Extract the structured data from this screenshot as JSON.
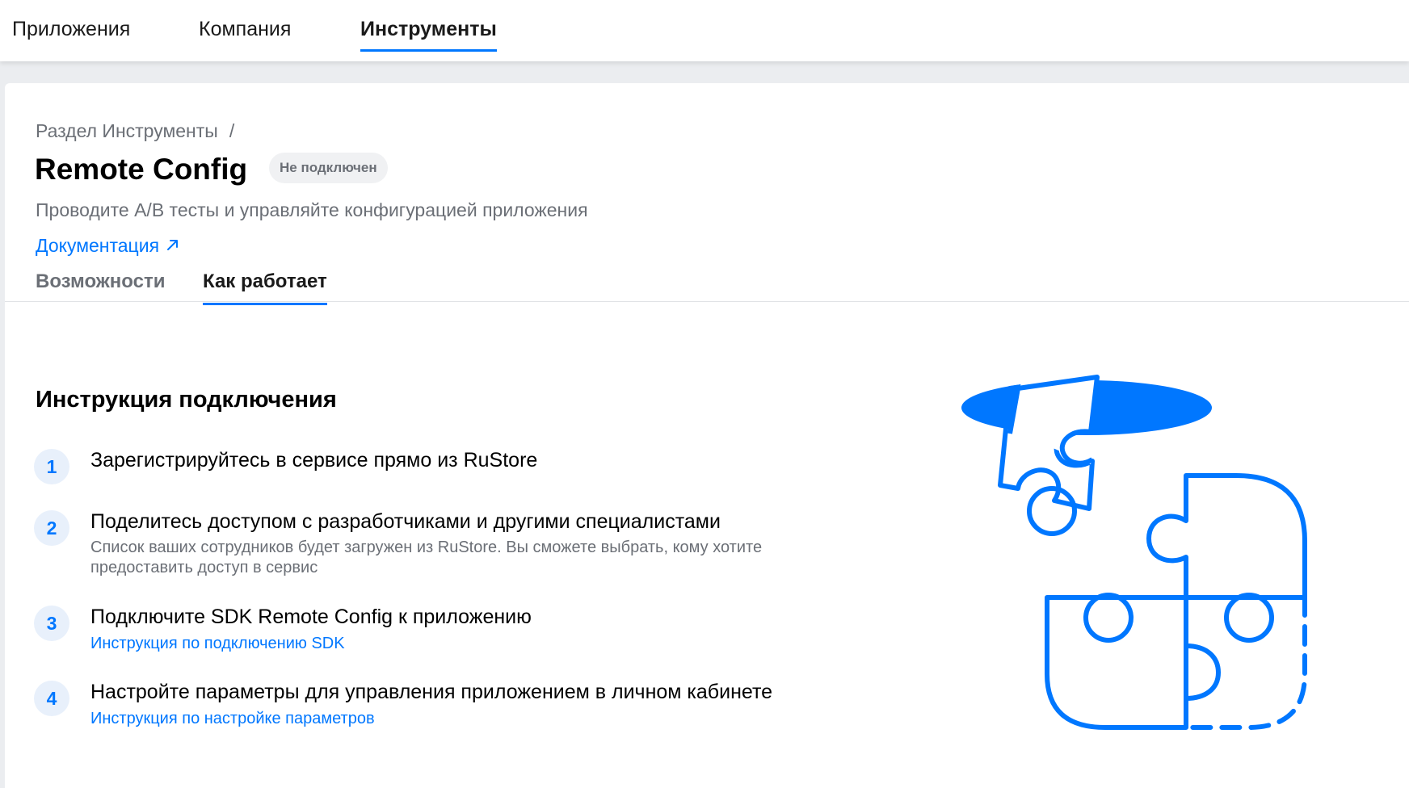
{
  "topnav": {
    "items": [
      {
        "label": "Приложения",
        "active": false
      },
      {
        "label": "Компания",
        "active": false
      },
      {
        "label": "Инструменты",
        "active": true
      }
    ]
  },
  "header": {
    "breadcrumb": "Раздел Инструменты",
    "breadcrumb_separator": "/",
    "title": "Remote Config",
    "status_badge": "Не подключен",
    "subtitle": "Проводите A/B тесты и управляйте конфигурацией приложения",
    "doc_link": "Документация"
  },
  "tabs": [
    {
      "label": "Возможности",
      "active": false
    },
    {
      "label": "Как работает",
      "active": true
    }
  ],
  "instructions": {
    "title": "Инструкция подключения",
    "steps": [
      {
        "number": "1",
        "title": "Зарегистрируйтесь в сервисе прямо из RuStore"
      },
      {
        "number": "2",
        "title": "Поделитесь доступом с разработчиками и другими специалистами",
        "description": "Список ваших сотрудников будет загружен из RuStore. Вы сможете выбрать, кому хотите предоставить доступ в сервис"
      },
      {
        "number": "3",
        "title": "Подключите SDK Remote Config к приложению",
        "link": "Инструкция по подключению SDK"
      },
      {
        "number": "4",
        "title": "Настройте параметры для управления приложением в личном кабинете",
        "link": "Инструкция по настройке параметров"
      }
    ]
  },
  "illustration": {
    "icon": "puzzle-illustration",
    "color": "#0077ff"
  },
  "colors": {
    "accent": "#0077ff",
    "muted_text": "#6b6f76",
    "badge_bg": "#f0f1f3",
    "step_bg": "#e8f0fb"
  }
}
